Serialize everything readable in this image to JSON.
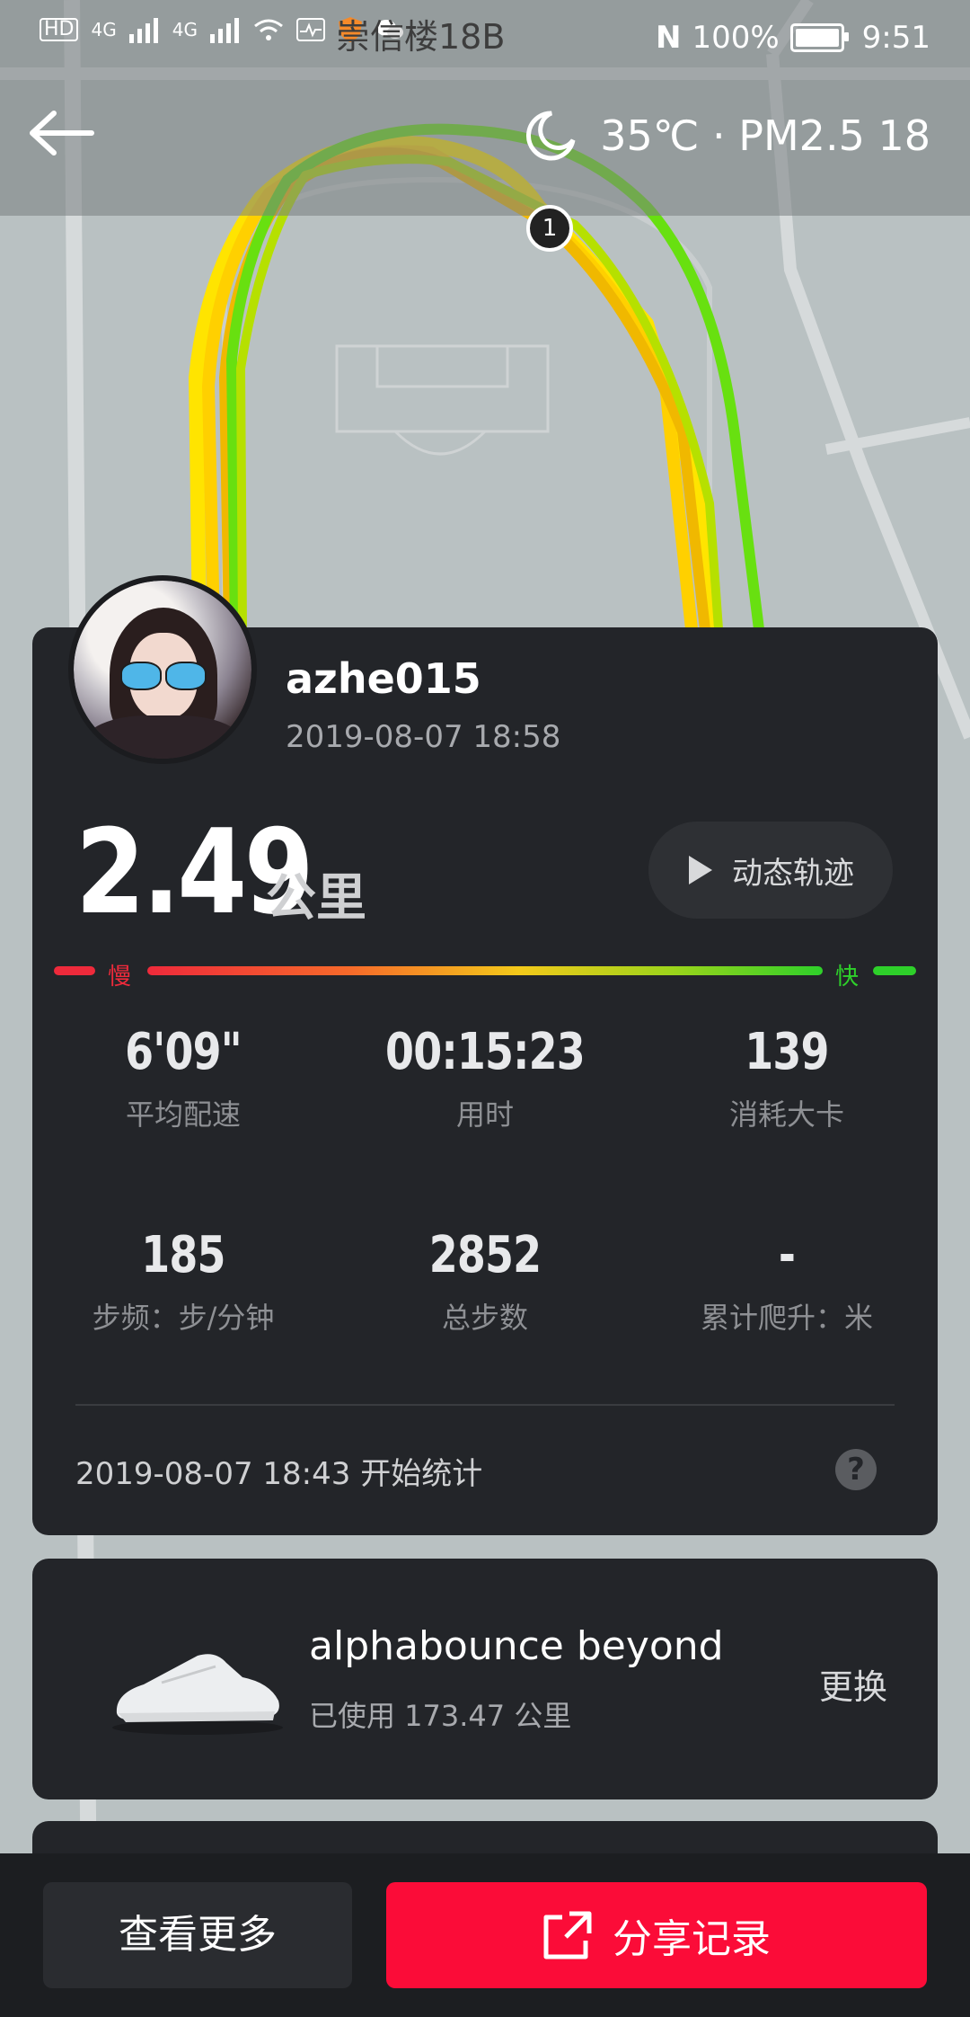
{
  "status_bar": {
    "network_a": "4G",
    "network_b": "4G",
    "location_label": "崇信楼18B",
    "battery_percent": "100%",
    "time": "9:51"
  },
  "header": {
    "weather_icon": "moon-icon",
    "weather_text": "35℃ · PM2.5 18"
  },
  "map": {
    "lap_marker": "1"
  },
  "run": {
    "username": "azhe015",
    "datetime": "2019-08-07 18:58",
    "distance_value": "2.49",
    "distance_unit": "公里",
    "replay_label": "动态轨迹",
    "speed_slow_label": "慢",
    "speed_fast_label": "快",
    "stats": [
      {
        "value": "6'09\"",
        "label": "平均配速"
      },
      {
        "value": "00:15:23",
        "label": "用时"
      },
      {
        "value": "139",
        "label": "消耗大卡"
      },
      {
        "value": "185",
        "label": "步频：步/分钟"
      },
      {
        "value": "2852",
        "label": "总步数"
      },
      {
        "value": "-",
        "label": "累计爬升：米"
      }
    ],
    "start_time": "2019-08-07 18:43  开始统计",
    "help_glyph": "?"
  },
  "shoe": {
    "name": "alphabounce beyond",
    "usage": "已使用 173.47 公里",
    "change_label": "更换"
  },
  "footer": {
    "more_label": "查看更多",
    "share_label": "分享记录"
  },
  "colors": {
    "card_bg": "#232529",
    "share_red": "#fb0c38",
    "slow_red": "#ee2a3b",
    "fast_green": "#2ed02a"
  }
}
